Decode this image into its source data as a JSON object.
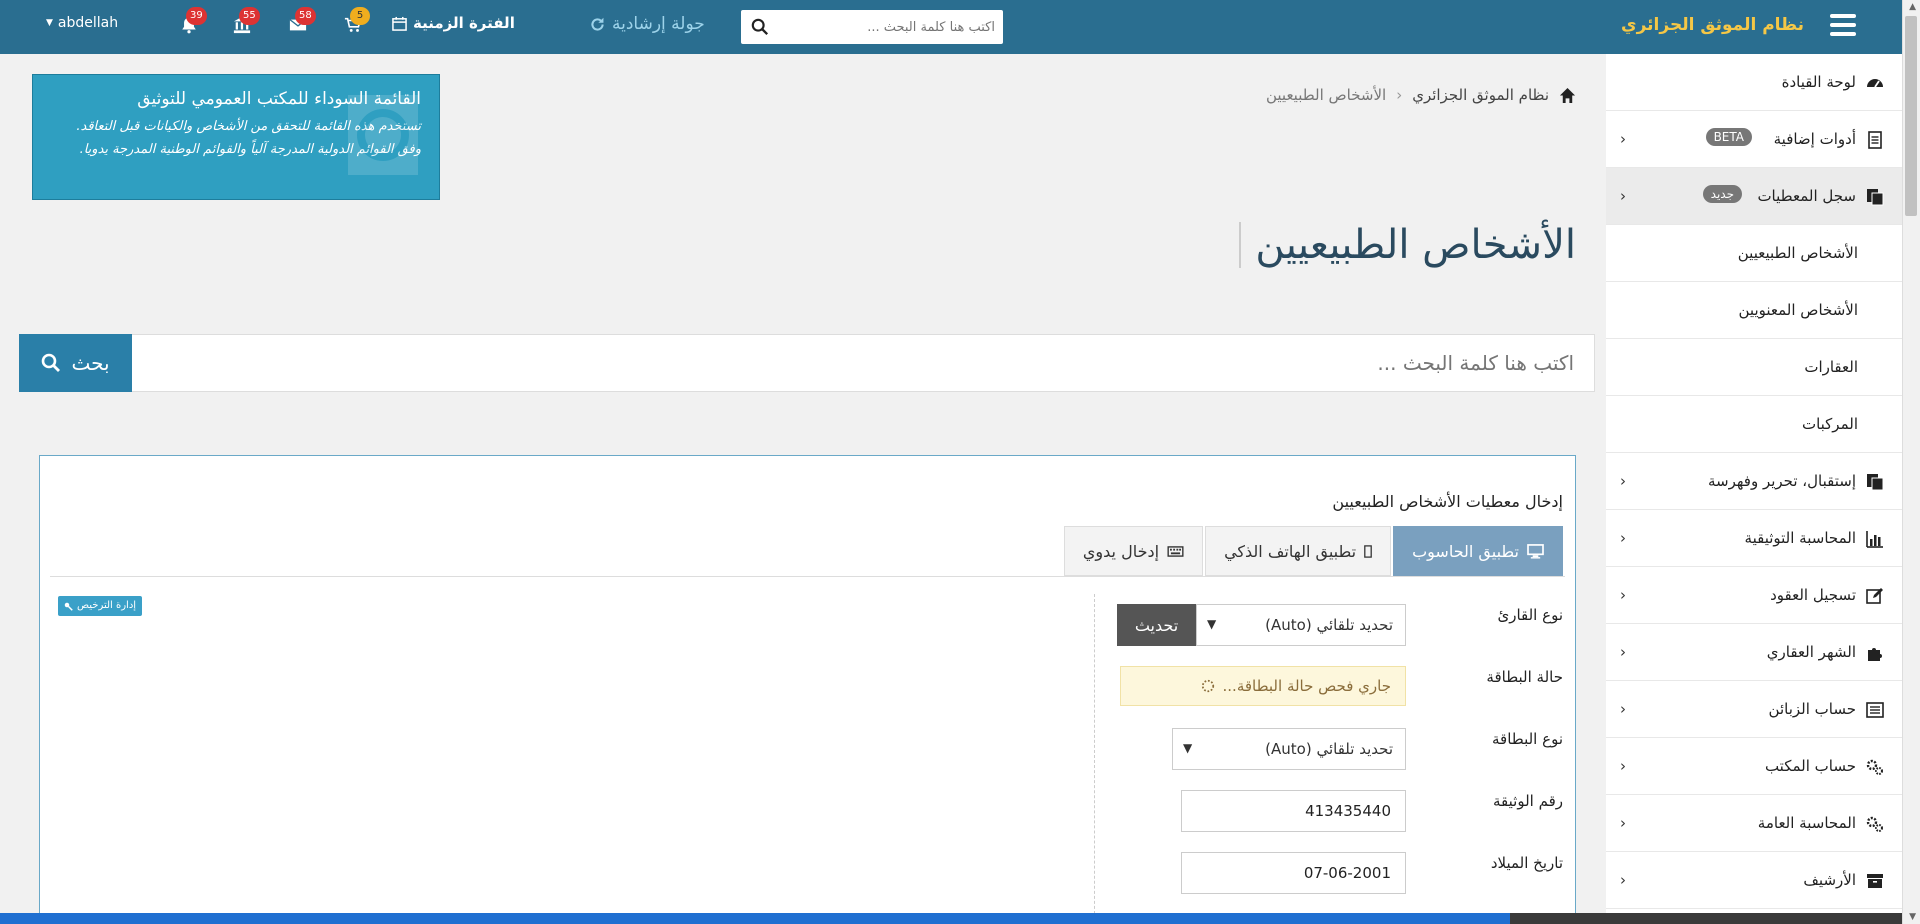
{
  "topbar": {
    "brand": "نظام الموثق الجزائري",
    "search_placeholder": "اكتب هنا كلمة البحث ...",
    "tour_label": "جولة إرشادية",
    "period_label": "الفترة الزمنية",
    "cart_count": "5",
    "mail_count": "58",
    "bank_count": "55",
    "bell_count": "39",
    "username": "abdellah"
  },
  "sidebar": {
    "items": [
      {
        "label": "لوحة القيادة",
        "icon": "dashboard-icon"
      },
      {
        "label": "أدوات إضافية",
        "pill": "BETA",
        "icon": "document-icon"
      },
      {
        "label": "سجل المعطيات",
        "pill": "جديد",
        "icon": "copy-icon"
      },
      {
        "label": "الأشخاص الطبيعيين"
      },
      {
        "label": "الأشخاص المعنويين"
      },
      {
        "label": "العقارات"
      },
      {
        "label": "المركبات"
      },
      {
        "label": "إستقبال، تحرير وفهرسة",
        "icon": "copy-icon"
      },
      {
        "label": "المحاسبة التوثيقية",
        "icon": "bar-chart-icon"
      },
      {
        "label": "تسجيل العقود",
        "icon": "edit-icon"
      },
      {
        "label": "الشهر العقاري",
        "icon": "puzzle-icon"
      },
      {
        "label": "حساب الزبائن",
        "icon": "list-icon"
      },
      {
        "label": "حساب المكتب",
        "icon": "cogs-icon"
      },
      {
        "label": "المحاسبة العامة",
        "icon": "cogs-icon"
      },
      {
        "label": "الأرشيف",
        "icon": "archive-icon"
      }
    ]
  },
  "breadcrumb": {
    "home": "نظام الموثق الجزائري",
    "current": "الأشخاص الطبيعيين"
  },
  "notice": {
    "title": "القائمة السوداء للمكتب العمومي للتوثيق",
    "text": "تستخدم هذه القائمة للتحقق من الأشخاص والكيانات قبل التعاقد. وفق القوائم الدولية المدرجة آلياً والقوائم الوطنية المدرجة يدويا."
  },
  "page_title": "الأشخاص الطبيعيين",
  "main_search": {
    "placeholder": "اكتب هنا كلمة البحث ...",
    "button": "بحث"
  },
  "panel": {
    "title": "إدخال معطيات الأشخاص الطبيعيين",
    "tabs": [
      "تطبيق الحاسوب",
      "تطبيق الهاتف الذكي",
      "إدخال يدوي"
    ],
    "license_button": "إدارة الترخيص",
    "fields": {
      "reader_type_label": "نوع القارئ",
      "reader_type_value": "تحديد تلقائي (Auto)",
      "update_button": "تحديث",
      "card_status_label": "حالة البطاقة",
      "card_status_value": "جاري فحص حالة البطاقة...",
      "card_type_label": "نوع البطاقة",
      "card_type_value": "تحديد تلقائي (Auto)",
      "doc_number_label": "رقم الوثيقة",
      "doc_number_value": "413435440",
      "birth_date_label": "تاريخ الميلاد",
      "birth_date_value": "07-06-2001"
    }
  },
  "colors": {
    "topbar": "#2a6e90",
    "brand": "#f5c746",
    "notice": "#2f9fc1",
    "tab_active": "#7aa0bf",
    "search_button": "#2a7fa8"
  }
}
